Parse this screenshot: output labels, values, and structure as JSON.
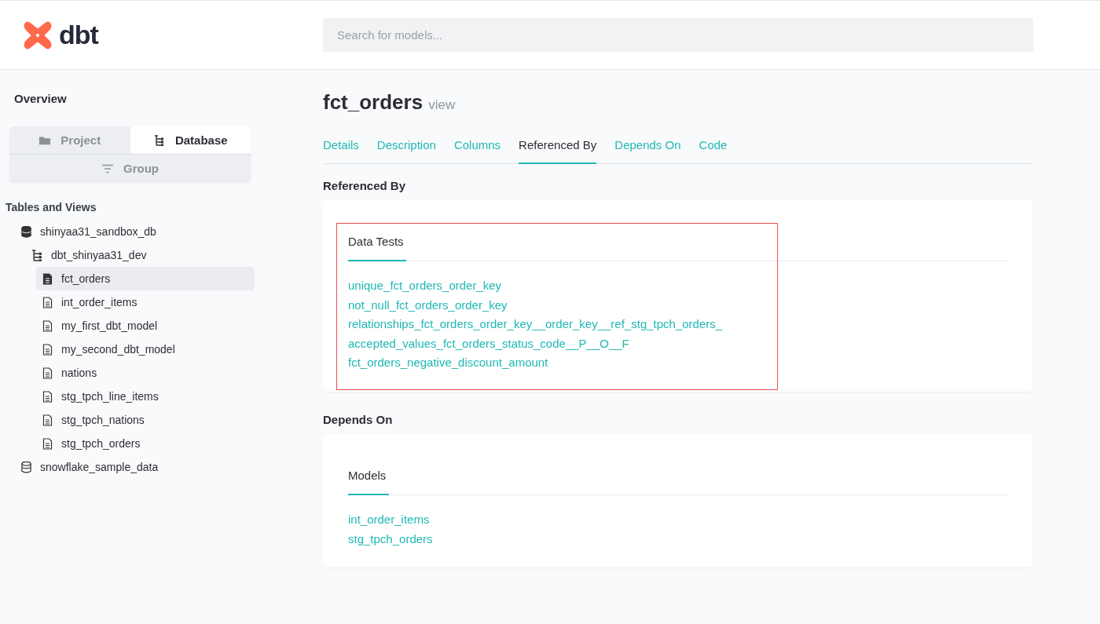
{
  "header": {
    "logo_text": "dbt",
    "search": {
      "placeholder": "Search for models..."
    }
  },
  "sidebar": {
    "title": "Overview",
    "view_switch": [
      {
        "label": "Project",
        "selected": false
      },
      {
        "label": "Database",
        "selected": true
      },
      {
        "label": "Group",
        "selected": false
      }
    ],
    "tree_title": "Tables and Views",
    "tree": [
      {
        "kind": "database",
        "label": "shinyaa31_sandbox_db",
        "children": [
          {
            "kind": "schema",
            "label": "dbt_shinyaa31_dev",
            "children": [
              {
                "kind": "model",
                "label": "fct_orders",
                "selected": true
              },
              {
                "kind": "model",
                "label": "int_order_items",
                "selected": false
              },
              {
                "kind": "model",
                "label": "my_first_dbt_model",
                "selected": false
              },
              {
                "kind": "model",
                "label": "my_second_dbt_model",
                "selected": false
              },
              {
                "kind": "model",
                "label": "nations",
                "selected": false
              },
              {
                "kind": "model",
                "label": "stg_tpch_line_items",
                "selected": false
              },
              {
                "kind": "model",
                "label": "stg_tpch_nations",
                "selected": false
              },
              {
                "kind": "model",
                "label": "stg_tpch_orders",
                "selected": false
              }
            ]
          }
        ]
      },
      {
        "kind": "database",
        "label": "snowflake_sample_data"
      }
    ]
  },
  "main": {
    "title": "fct_orders",
    "type": "view",
    "tabs": [
      {
        "label": "Details",
        "selected": false
      },
      {
        "label": "Description",
        "selected": false
      },
      {
        "label": "Columns",
        "selected": false
      },
      {
        "label": "Referenced By",
        "selected": true
      },
      {
        "label": "Depends On",
        "selected": false
      },
      {
        "label": "Code",
        "selected": false
      }
    ],
    "sections": [
      {
        "heading": "Referenced By",
        "group_tab": "Data Tests",
        "highlighted": true,
        "links": [
          "unique_fct_orders_order_key",
          "not_null_fct_orders_order_key",
          "relationships_fct_orders_order_key__order_key__ref_stg_tpch_orders_",
          "accepted_values_fct_orders_status_code__P__O__F",
          "fct_orders_negative_discount_amount"
        ]
      },
      {
        "heading": "Depends On",
        "group_tab": "Models",
        "highlighted": false,
        "links": [
          "int_order_items",
          "stg_tpch_orders"
        ]
      }
    ]
  }
}
